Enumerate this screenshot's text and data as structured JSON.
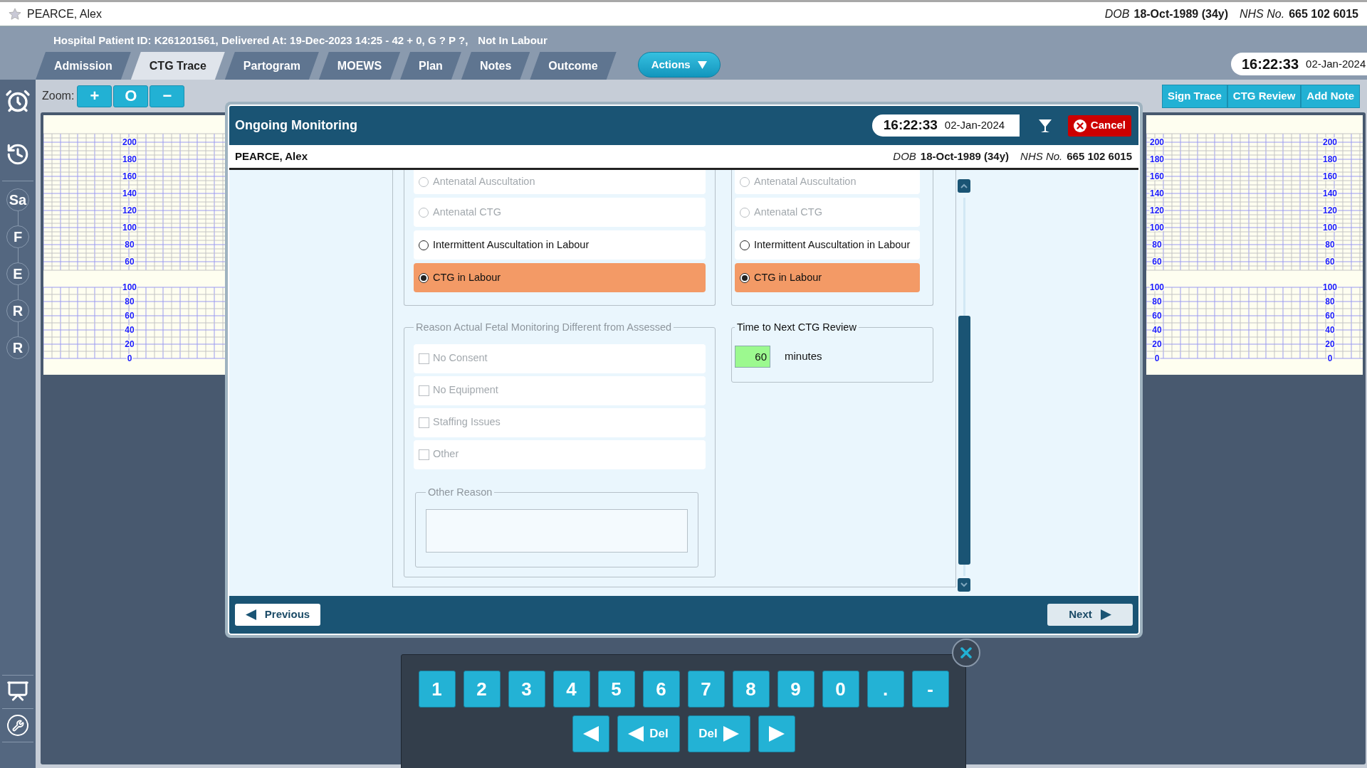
{
  "top_bar": {
    "patient_name": "PEARCE, Alex",
    "dob_label": "DOB",
    "dob": "18-Oct-1989 (34y)",
    "nhs_label": "NHS No.",
    "nhs_number": "665 102 6015"
  },
  "info_line": "Hospital Patient ID: K261201561, Delivered At: 19-Dec-2023 14:25 - 42 + 0, G ? P ?,",
  "labour_status": "Not In Labour",
  "tabs": [
    {
      "label": "Admission",
      "selected": false
    },
    {
      "label": "CTG Trace",
      "selected": true
    },
    {
      "label": "Partogram",
      "selected": false
    },
    {
      "label": "MOEWS",
      "selected": false
    },
    {
      "label": "Plan",
      "selected": false
    },
    {
      "label": "Notes",
      "selected": false
    },
    {
      "label": "Outcome",
      "selected": false
    }
  ],
  "actions_button": "Actions",
  "clock": {
    "time": "16:22:33",
    "date": "02-Jan-2024"
  },
  "sidebar": {
    "stages": [
      "Sa",
      "F",
      "E",
      "R",
      "R"
    ]
  },
  "zoom": {
    "label": "Zoom:",
    "buttons": [
      "+",
      "O",
      "−"
    ]
  },
  "trace_buttons": [
    "Sign Trace",
    "CTG Review",
    "Add Note"
  ],
  "trace_panels": [
    {
      "axes": [
        {
          "fhr_labels": [
            "200",
            "180",
            "160",
            "140",
            "120",
            "100",
            "80",
            "60"
          ],
          "toco_labels": [
            "100",
            "80",
            "60",
            "40",
            "20",
            "0"
          ]
        }
      ]
    },
    {
      "axes": [
        {
          "fhr_labels": [
            "200",
            "180",
            "160",
            "140",
            "120",
            "100",
            "80",
            "60"
          ],
          "toco_labels": [
            "100",
            "80",
            "60",
            "40",
            "20",
            "0"
          ]
        },
        {
          "fhr_labels": [
            "200",
            "180",
            "160",
            "140",
            "120",
            "100",
            "80",
            "60"
          ],
          "toco_labels": [
            "100",
            "80",
            "60",
            "40",
            "20",
            "0"
          ]
        }
      ]
    }
  ],
  "dialog": {
    "title": "Ongoing Monitoring",
    "time": "16:22:33",
    "date": "02-Jan-2024",
    "cancel_label": "Cancel",
    "patient": {
      "patient_name": "PEARCE, Alex",
      "dob_label": "DOB",
      "dob": "18-Oct-1989 (34y)",
      "nhs_label": "NHS No.",
      "nhs_number": "665 102 6015"
    },
    "assessed_options": [
      {
        "label": "Antenatal Auscultation",
        "selected": false,
        "disabled": true
      },
      {
        "label": "Antenatal CTG",
        "selected": false,
        "disabled": true
      },
      {
        "label": "Intermittent Auscultation in Labour",
        "selected": false,
        "disabled": false
      },
      {
        "label": "CTG in Labour",
        "selected": true,
        "disabled": false
      }
    ],
    "actual_options": [
      {
        "label": "Antenatal Auscultation",
        "selected": false,
        "disabled": true
      },
      {
        "label": "Antenatal CTG",
        "selected": false,
        "disabled": true
      },
      {
        "label": "Intermittent Auscultation in Labour",
        "selected": false,
        "disabled": false
      },
      {
        "label": "CTG in Labour",
        "selected": true,
        "disabled": false
      }
    ],
    "reason": {
      "legend": "Reason Actual Fetal Monitoring Different from Assessed",
      "disabled": true,
      "options": [
        {
          "label": "No Consent",
          "checked": false,
          "disabled": true
        },
        {
          "label": "No Equipment",
          "checked": false,
          "disabled": true
        },
        {
          "label": "Staffing Issues",
          "checked": false,
          "disabled": true
        },
        {
          "label": "Other",
          "checked": false,
          "disabled": true
        }
      ],
      "other_reason_legend": "Other Reason"
    },
    "review": {
      "legend": "Time to Next CTG Review",
      "value": "60",
      "unit": "minutes"
    },
    "previous_label": "Previous",
    "next_label": "Next"
  },
  "keypad": {
    "keys": [
      "1",
      "2",
      "3",
      "4",
      "5",
      "6",
      "7",
      "8",
      "9",
      "0",
      ".",
      "-"
    ],
    "edit_keys": [
      {
        "kind": "left"
      },
      {
        "kind": "delete-left",
        "label": "Del"
      },
      {
        "kind": "delete-right",
        "label": "Del"
      },
      {
        "kind": "right"
      }
    ]
  }
}
